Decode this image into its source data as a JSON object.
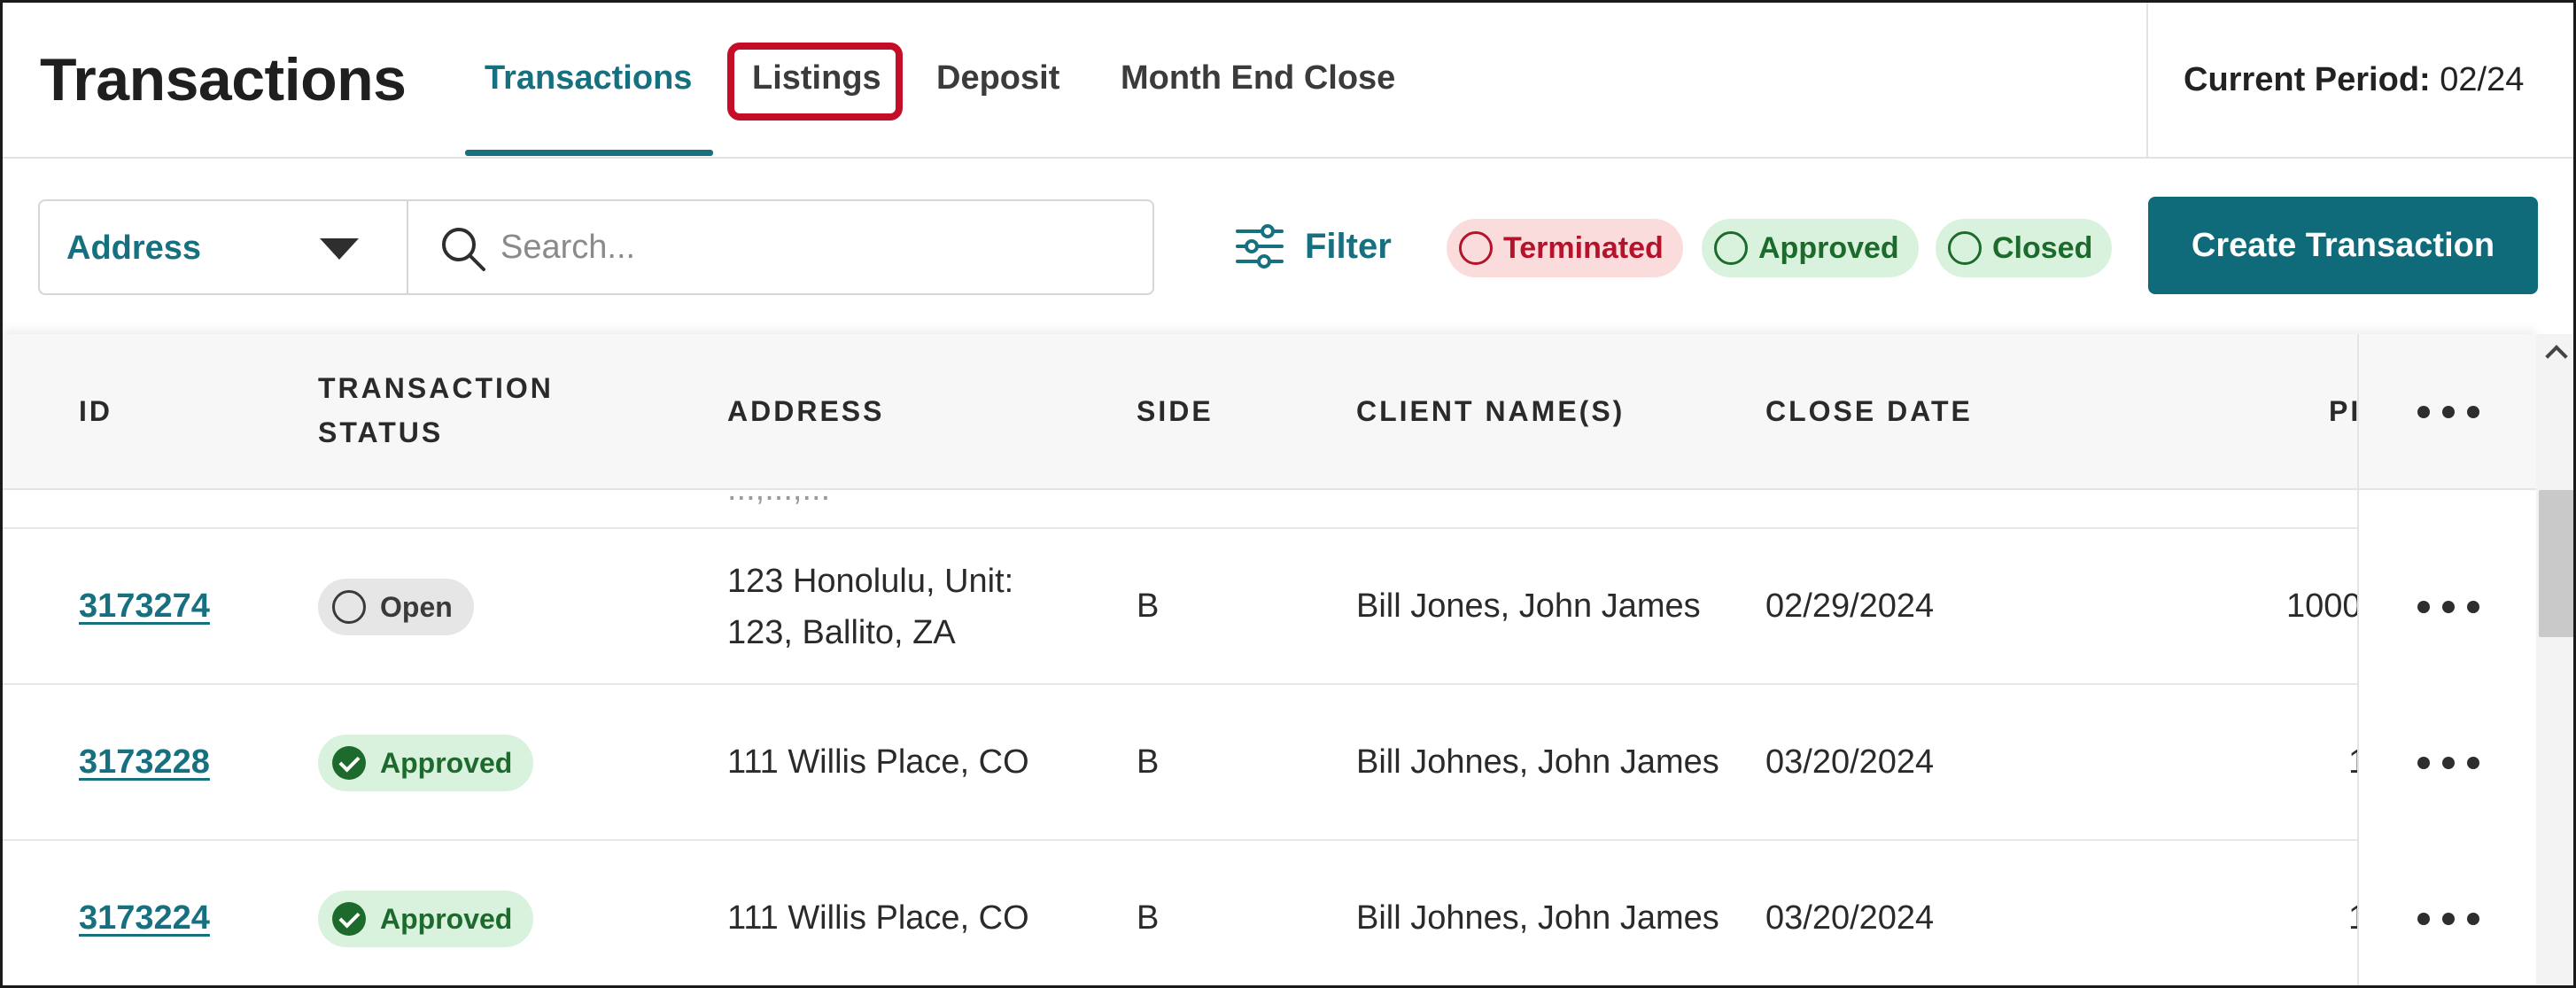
{
  "header": {
    "title": "Transactions",
    "tabs": [
      {
        "label": "Transactions",
        "active": true
      },
      {
        "label": "Listings",
        "highlighted": true
      },
      {
        "label": "Deposit"
      },
      {
        "label": "Month End Close"
      }
    ],
    "period_label": "Current Period:",
    "period_value": "02/24"
  },
  "toolbar": {
    "search_by": "Address",
    "search_placeholder": "Search...",
    "filter_label": "Filter",
    "chips": [
      "Terminated",
      "Approved",
      "Closed"
    ],
    "create_label": "Create Transaction"
  },
  "table": {
    "columns": [
      "ID",
      "TRANSACTION",
      "STATUS",
      "ADDRESS",
      "SIDE",
      "CLIENT NAME(S)",
      "CLOSE DATE",
      "PI"
    ],
    "partial_row_text": "...,...,...",
    "rows": [
      {
        "id": "3173274",
        "status": "Open",
        "address_line1": "123 Honolulu, Unit:",
        "address_line2": "123, Ballito, ZA",
        "side": "B",
        "clients": "Bill Jones, John James",
        "close_date": "02/29/2024",
        "price": "1000"
      },
      {
        "id": "3173228",
        "status": "Approved",
        "address_line1": "111 Willis Place, CO",
        "address_line2": "",
        "side": "B",
        "clients": "Bill Johnes, John James",
        "close_date": "03/20/2024",
        "price": "1"
      },
      {
        "id": "3173224",
        "status": "Approved",
        "address_line1": "111 Willis Place, CO",
        "address_line2": "",
        "side": "B",
        "clients": "Bill Johnes, John James",
        "close_date": "03/20/2024",
        "price": "1"
      }
    ]
  },
  "colors": {
    "accent": "#17707f",
    "primary_button": "#0f6a7a",
    "highlight": "#c40e28",
    "approved_bg": "#d9f2dd",
    "approved_fg": "#1d6b2c",
    "terminated_bg": "#fbdcdc",
    "terminated_fg": "#b5122c"
  },
  "icons": {
    "search": "search-icon",
    "filter": "filter-sliders-icon",
    "dropdown": "caret-down-icon",
    "more": "more-dots-icon",
    "check": "check-circle-icon"
  }
}
